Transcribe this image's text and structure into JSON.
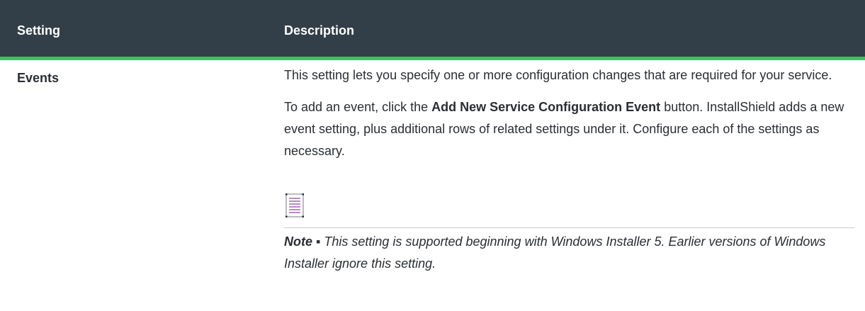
{
  "table": {
    "headers": {
      "setting": "Setting",
      "description": "Description"
    },
    "row": {
      "setting": "Events",
      "paragraph1": "This setting lets you specify one or more configuration changes that are required for your service.",
      "paragraph2_before": "To add an event, click the ",
      "paragraph2_bold": "Add New Service Configuration Event",
      "paragraph2_after": " button. InstallShield adds a new event setting, plus additional rows of related settings under it. Configure each of the settings as necessary.",
      "note_label": "Note ▪",
      "note_text": " This setting is supported beginning with Windows Installer 5. Earlier versions of Windows Installer ignore this setting."
    }
  },
  "icons": {
    "note": "note-icon"
  },
  "colors": {
    "header_bg": "#323f48",
    "header_accent": "#34c759",
    "note_icon": "#8a3fa0"
  }
}
